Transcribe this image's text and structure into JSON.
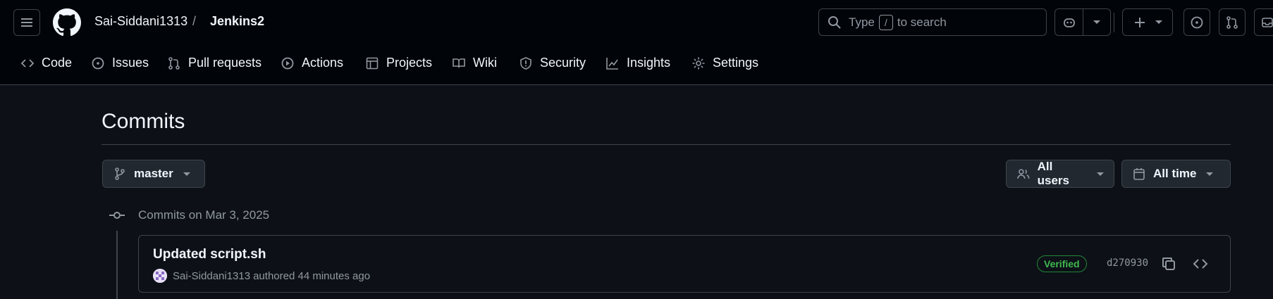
{
  "header": {
    "owner": "Sai-Siddani1313",
    "separator": "/",
    "repo": "Jenkins2",
    "search": {
      "prefix": "Type",
      "key": "/",
      "suffix": "to search"
    }
  },
  "nav": {
    "items": [
      {
        "label": "Code",
        "icon": "code-icon"
      },
      {
        "label": "Issues",
        "icon": "issue-icon"
      },
      {
        "label": "Pull requests",
        "icon": "pull-request-icon"
      },
      {
        "label": "Actions",
        "icon": "play-icon"
      },
      {
        "label": "Projects",
        "icon": "table-icon"
      },
      {
        "label": "Wiki",
        "icon": "book-icon"
      },
      {
        "label": "Security",
        "icon": "shield-icon"
      },
      {
        "label": "Insights",
        "icon": "graph-icon"
      },
      {
        "label": "Settings",
        "icon": "gear-icon"
      }
    ]
  },
  "page": {
    "title": "Commits",
    "branch": "master",
    "users_filter": "All users",
    "time_filter": "All time"
  },
  "commit_groups": [
    {
      "date_label": "Commits on Mar 3, 2025",
      "commits": [
        {
          "title": "Updated script.sh",
          "author": "Sai-Siddani1313",
          "meta": "authored 44 minutes ago",
          "badge": "Verified",
          "sha": "d270930"
        }
      ]
    }
  ],
  "colors": {
    "header_bg": "#010409",
    "page_bg": "#0d1117",
    "border": "#3d444d",
    "text": "#f0f6fc",
    "muted": "#9198a1",
    "verified": "#3fb950"
  }
}
